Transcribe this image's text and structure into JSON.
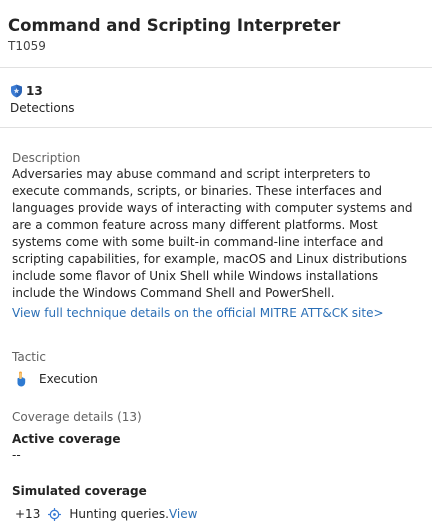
{
  "header": {
    "title": "Command and Scripting Interpreter",
    "technique_id": "T1059"
  },
  "detections": {
    "count": "13",
    "label": "Detections",
    "icon": "shield-icon"
  },
  "description": {
    "heading": "Description",
    "text": "Adversaries may abuse command and script interpreters to execute commands, scripts, or binaries. These interfaces and languages provide ways of interacting with computer systems and are a common feature across many different platforms. Most systems come with some built-in command-line interface and scripting capabilities, for example, macOS and Linux distributions include some flavor of Unix Shell while Windows installations include the Windows Command Shell and PowerShell.",
    "link_label": "View full technique details on the official MITRE ATT&CK site>"
  },
  "tactic": {
    "heading": "Tactic",
    "value": "Execution",
    "icon": "execution-icon"
  },
  "coverage": {
    "heading": "Coverage details (13)",
    "active": {
      "heading": "Active coverage",
      "value": "--"
    },
    "simulated": {
      "heading": "Simulated coverage",
      "count": "+13",
      "icon": "target-icon",
      "label": "Hunting queries.",
      "link_label": "View"
    }
  },
  "colors": {
    "link": "#2b6fb6",
    "shield": "#3b7bd4",
    "divider": "#e1e1e1"
  }
}
